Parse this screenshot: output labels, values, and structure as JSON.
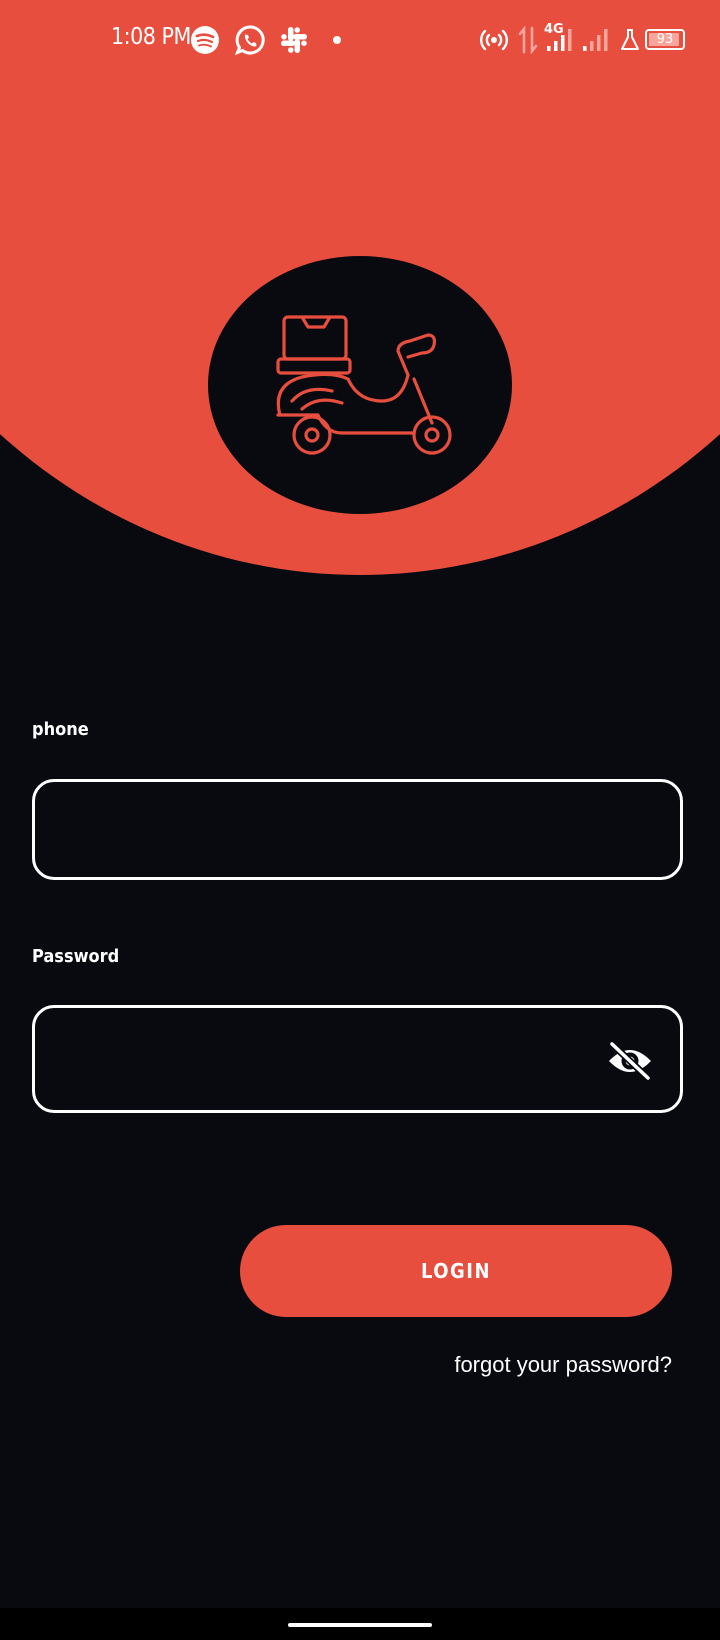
{
  "status_bar": {
    "time": "1:08 PM",
    "network": "4G",
    "battery": "93",
    "icons": [
      "spotify-icon",
      "whatsapp-icon",
      "slack-icon",
      "notification-dot-icon",
      "hotspot-icon",
      "data-transfer-icon",
      "signal-icon",
      "signal-weak-icon",
      "lab-icon",
      "battery-icon"
    ]
  },
  "logo": {
    "icon": "delivery-scooter-icon",
    "color": "#e84e3e"
  },
  "form": {
    "phone_label": "phone",
    "phone_value": "",
    "password_label": "Password",
    "password_value": "",
    "password_toggle_icon": "eye-off-icon",
    "login_label": "LOGIN",
    "forgot_label": "forgot your password?"
  },
  "theme": {
    "accent": "#e84e3e",
    "background": "#080a0f",
    "text": "#ffffff"
  }
}
